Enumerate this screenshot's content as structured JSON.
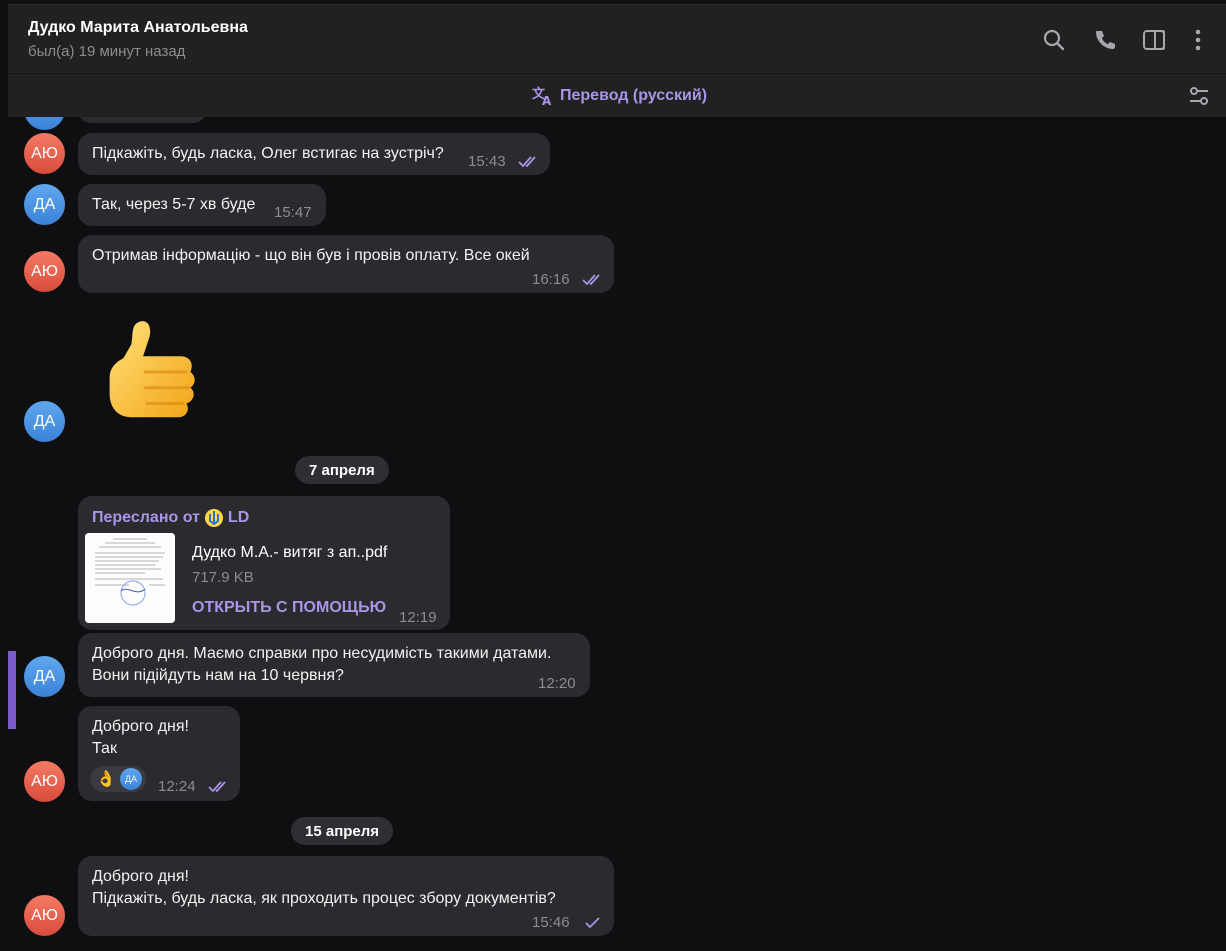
{
  "header": {
    "contact_name": "Дудко Марита Анатольевна",
    "status": "был(а) 19 минут назад"
  },
  "translation_bar": {
    "label": "Перевод (русский)"
  },
  "avatars": {
    "ayu": "АЮ",
    "da": "ДА"
  },
  "messages": [
    {
      "sender": "АЮ",
      "text": "Підкажіть, будь ласка, Олег встигає на зустріч?",
      "time": "15:43",
      "read": true
    },
    {
      "sender": "ДА",
      "text": "Так, через 5-7 хв буде",
      "time": "15:47"
    },
    {
      "sender": "АЮ",
      "text": "Отримав інформацію - що він був і провів оплату. Все окей",
      "time": "16:16",
      "read": true
    },
    {
      "sender": "ДА",
      "sticker": "thumbs-up"
    },
    {
      "date": "7 апреля"
    },
    {
      "sender": "ДА",
      "forwarded_label": "Переслано от",
      "forwarded_from": "LD",
      "file_name": "Дудко М.А.- витяг з ап..pdf",
      "file_size": "717.9 KB",
      "action": "ОТКРЫТЬ С ПОМОЩЬЮ",
      "time": "12:19"
    },
    {
      "sender": "ДА",
      "text_line1": "Доброго дня. Маємо справки про несудимість такими датами.",
      "text_line2": "Вони підійдуть нам на 10 червня?",
      "time": "12:20"
    },
    {
      "sender": "АЮ",
      "text_line1": "Доброго дня!",
      "text_line2": "Так",
      "time": "12:24",
      "read": true,
      "reaction": "👌",
      "reaction_user": "ДА"
    },
    {
      "date": "15 апреля"
    },
    {
      "sender": "АЮ",
      "text_line1": "Доброго дня!",
      "text_line2": "Підкажіть, будь ласка, як проходить процес збору документів?",
      "time": "15:46",
      "read": false
    }
  ],
  "colors": {
    "accent": "#a995e8",
    "bubble": "#2b2b2f",
    "background": "#0f0f12"
  }
}
